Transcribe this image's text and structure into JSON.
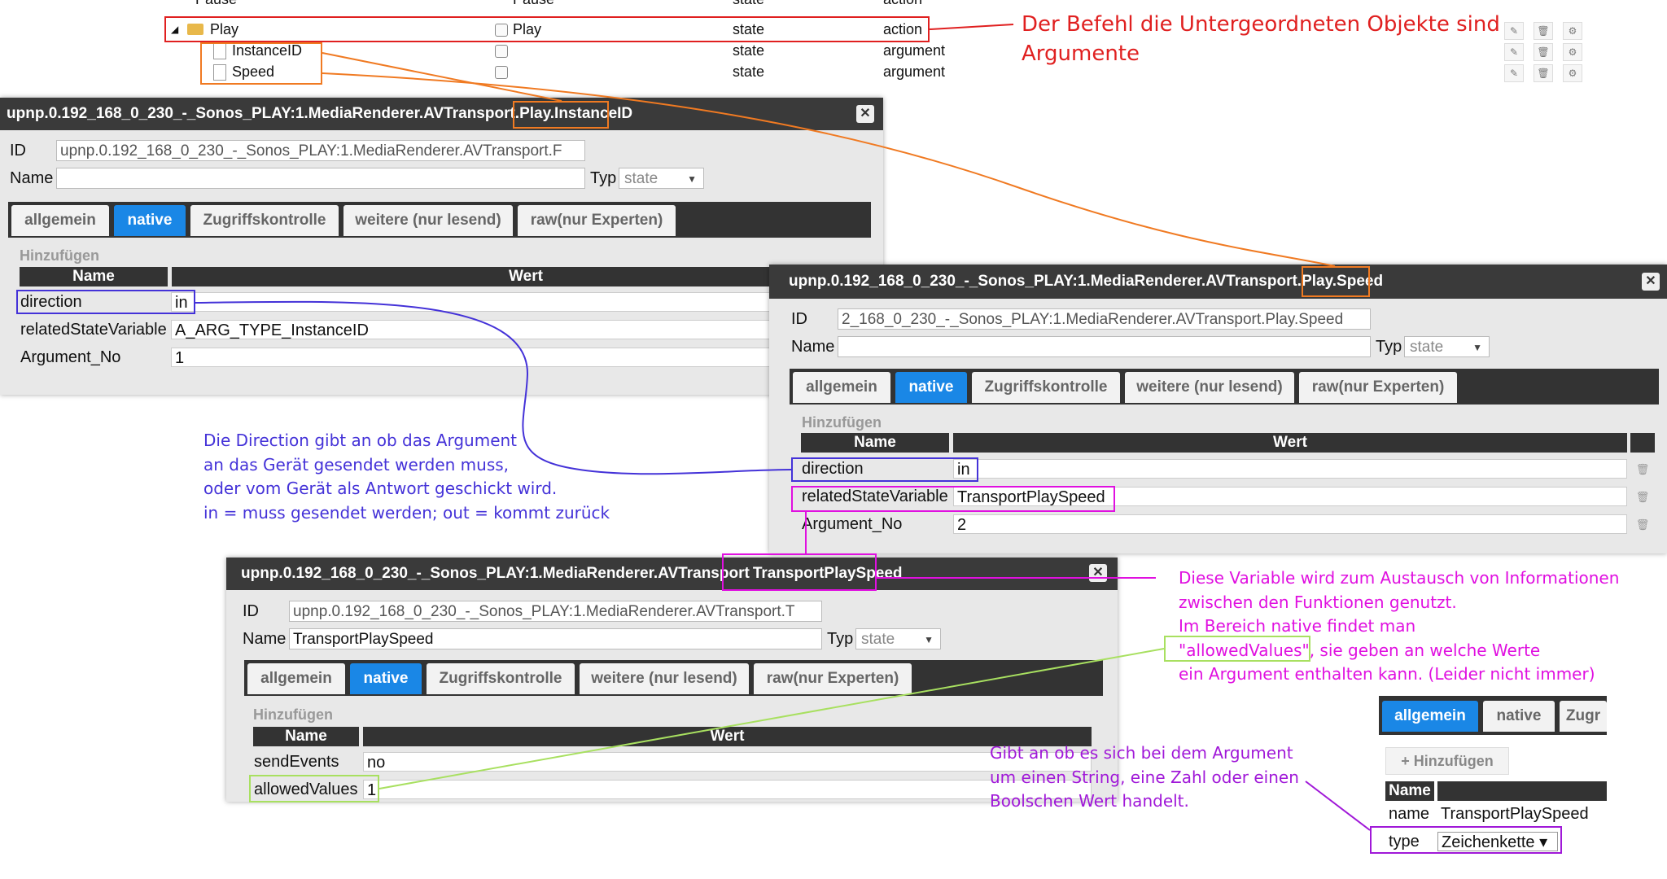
{
  "tree": {
    "rows": [
      {
        "name": "Pause",
        "role": "Pause",
        "type": "state",
        "roleName": "action"
      },
      {
        "name": "Play",
        "role": "Play",
        "type": "state",
        "roleName": "action"
      },
      {
        "name": "InstanceID",
        "role": "",
        "type": "state",
        "roleName": "argument"
      },
      {
        "name": "Speed",
        "role": "",
        "type": "state",
        "roleName": "argument"
      }
    ]
  },
  "dialog1": {
    "title_prefix": "upnp.0.192_168_0_230_-_Sonos_PLAY:1.MediaRenderer.AVTransport.Play.",
    "title_highlight": "InstanceID",
    "id_label": "ID",
    "id_value": "upnp.0.192_168_0_230_-_Sonos_PLAY:1.MediaRenderer.AVTransport.F",
    "name_label": "Name",
    "name_value": "",
    "typ_label": "Typ",
    "typ_value": "state",
    "tabs": [
      "allgemein",
      "native",
      "Zugriffskontrolle",
      "weitere (nur lesend)",
      "raw(nur Experten)"
    ],
    "add_label": "Hinzufügen",
    "col_name": "Name",
    "col_value": "Wert",
    "rows": [
      {
        "name": "direction",
        "value": "in"
      },
      {
        "name": "relatedStateVariable",
        "value": "A_ARG_TYPE_InstanceID"
      },
      {
        "name": "Argument_No",
        "value": "1"
      }
    ]
  },
  "dialog2": {
    "title_prefix": "upnp.0.192_168_0_230_-_Sonos_PLAY:1.MediaRenderer.AVTransport.Play",
    "title_highlight": ".Speed",
    "id_label": "ID",
    "id_value": "2_168_0_230_-_Sonos_PLAY:1.MediaRenderer.AVTransport.Play.Speed",
    "name_label": "Name",
    "name_value": "",
    "typ_label": "Typ",
    "typ_value": "state",
    "tabs": [
      "allgemein",
      "native",
      "Zugriffskontrolle",
      "weitere (nur lesend)",
      "raw(nur Experten)"
    ],
    "add_label": "Hinzufügen",
    "col_name": "Name",
    "col_value": "Wert",
    "rows": [
      {
        "name": "direction",
        "value": "in"
      },
      {
        "name": "relatedStateVariable",
        "value": "TransportPlaySpeed"
      },
      {
        "name": "Argument_No",
        "value": "2"
      }
    ]
  },
  "dialog3": {
    "title_prefix": "upnp.0.192_168_0_230_-_Sonos_PLAY:1.MediaRenderer.AVTransport",
    "title_highlight": "TransportPlaySpeed",
    "id_label": "ID",
    "id_value": "upnp.0.192_168_0_230_-_Sonos_PLAY:1.MediaRenderer.AVTransport.T",
    "name_label": "Name",
    "name_value": "TransportPlaySpeed",
    "typ_label": "Typ",
    "typ_value": "state",
    "tabs": [
      "allgemein",
      "native",
      "Zugriffskontrolle",
      "weitere (nur lesend)",
      "raw(nur Experten)"
    ],
    "add_label": "Hinzufügen",
    "col_name": "Name",
    "col_value": "Wert",
    "rows": [
      {
        "name": "sendEvents",
        "value": "no"
      },
      {
        "name": "allowedValues",
        "value": "1"
      }
    ]
  },
  "dialog4": {
    "tabs": [
      "allgemein",
      "native",
      "Zugr"
    ],
    "add_label": "+ Hinzufügen",
    "col_name": "Name",
    "rows": [
      {
        "name": "name",
        "value": "TransportPlaySpeed"
      },
      {
        "name": "type",
        "value": "Zeichenkette ▾"
      }
    ]
  },
  "annotations": {
    "red": [
      "Der Befehl die Untergeordneten Objekte sind",
      "Argumente"
    ],
    "blue": [
      "Die Direction gibt an ob das Argument",
      "an das Gerät gesendet werden muss,",
      "oder vom Gerät als Antwort geschickt wird.",
      "in = muss gesendet werden; out = kommt zurück"
    ],
    "magenta_1": [
      "Diese Variable wird zum Austausch von Informationen",
      "zwischen den Funktionen genutzt.",
      "Im Bereich native findet man"
    ],
    "magenta_quote": "\"allowedValues\"",
    "magenta_quote_rest": ", sie geben an welche Werte",
    "magenta_2": "ein Argument enthalten kann. (Leider nicht immer)",
    "purple": [
      "Gibt an ob es sich bei dem Argument",
      "um einen String, eine Zahl oder einen",
      "Boolschen Wert handelt."
    ]
  },
  "colors": {
    "red": "#e02020",
    "orange": "#f07a22",
    "blue": "#4432d8",
    "magenta": "#e010e0",
    "lime": "#a8e060",
    "purple": "#a018d8",
    "tab_active": "#1a87e6"
  }
}
